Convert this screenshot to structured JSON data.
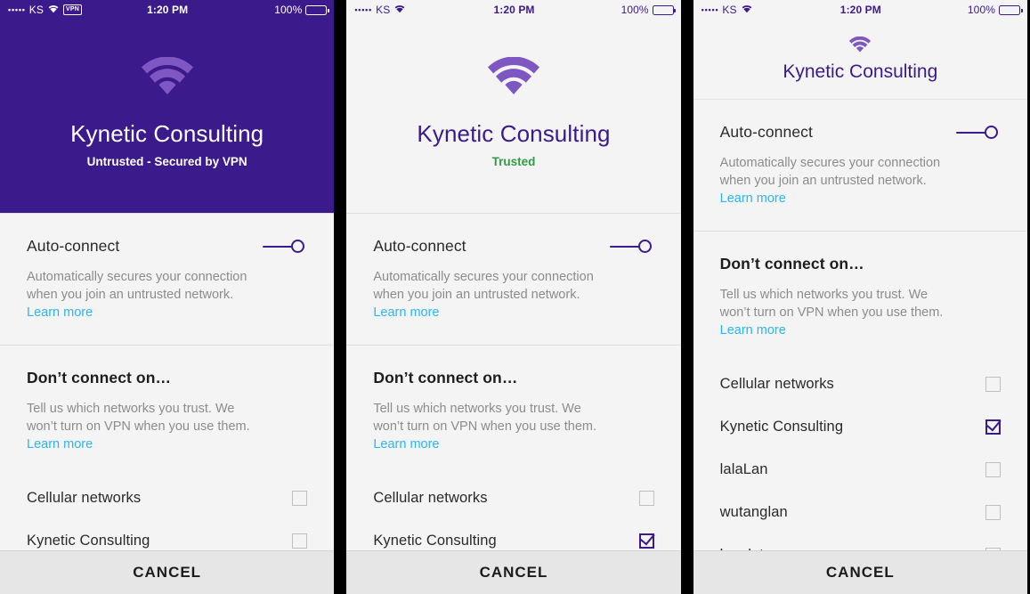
{
  "status_bar": {
    "signal_dots": "•••••",
    "carrier": "KS",
    "vpn_badge": "VPN",
    "time": "1:20 PM",
    "battery_percent": "100%"
  },
  "colors": {
    "brand_purple": "#3b1a8c",
    "wifi_purple": "#7e57c2",
    "link_blue": "#29b6f6",
    "trusted_green": "#2e9e44",
    "panel_bg": "#f4f4f4",
    "cancel_bg": "#e6e6e6"
  },
  "strings": {
    "auto_connect_label": "Auto-connect",
    "auto_connect_desc": "Automatically secures your connection when you join an untrusted network.",
    "learn_more": "Learn more",
    "dont_connect_title": "Don’t connect on…",
    "dont_connect_desc": "Tell us which networks you trust. We won’t turn on VPN when you use them.",
    "cancel_label": "CANCEL"
  },
  "panels": [
    {
      "id": "untrusted-vpn-on",
      "theme": "dark",
      "shows_vpn_badge": true,
      "header": {
        "type": "hero",
        "network_name": "Kynetic Consulting",
        "network_status": "Untrusted - Secured by VPN"
      },
      "auto_connect": {
        "label": "Auto-connect",
        "enabled": true
      },
      "networks": [
        {
          "name": "Cellular networks",
          "checked": false
        },
        {
          "name": "Kynetic Consulting",
          "checked": false
        }
      ]
    },
    {
      "id": "trusted",
      "theme": "light",
      "shows_vpn_badge": false,
      "header": {
        "type": "hero",
        "network_name": "Kynetic Consulting",
        "network_status": "Trusted"
      },
      "auto_connect": {
        "label": "Auto-connect",
        "enabled": true
      },
      "networks": [
        {
          "name": "Cellular networks",
          "checked": false
        },
        {
          "name": "Kynetic Consulting",
          "checked": true
        }
      ]
    },
    {
      "id": "scrolled-list",
      "theme": "light",
      "shows_vpn_badge": false,
      "header": {
        "type": "compact",
        "network_name": "Kynetic Consulting",
        "network_status": ""
      },
      "auto_connect": {
        "label": "Auto-connect",
        "enabled": true
      },
      "networks": [
        {
          "name": "Cellular networks",
          "checked": false
        },
        {
          "name": "Kynetic Consulting",
          "checked": true
        },
        {
          "name": "lalaLan",
          "checked": false
        },
        {
          "name": "wutanglan",
          "checked": false
        },
        {
          "name": "lanalot",
          "checked": false
        }
      ]
    }
  ]
}
